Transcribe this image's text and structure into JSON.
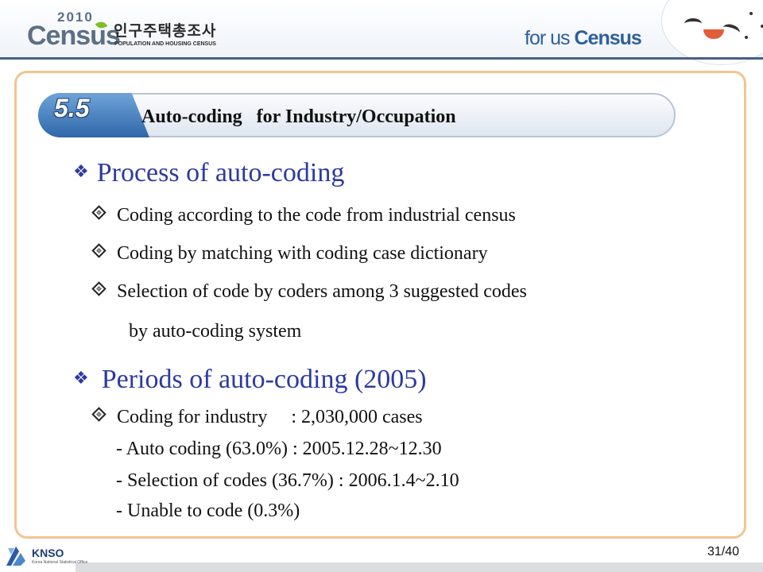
{
  "header": {
    "logo_year": "2010",
    "logo_word": "Census",
    "logo_korean": "인구주택총조사",
    "logo_subtitle": "POPULATION AND HOUSING CENSUS",
    "slogan_prefix": "for us ",
    "slogan_word": "Census"
  },
  "section": {
    "number": "5.5",
    "title": "Auto-coding   for Industry/Occupation"
  },
  "content": {
    "heading1": "Process of auto-coding",
    "items1": [
      "Coding according to the code from industrial census",
      "Coding by matching with coding case dictionary",
      "Selection of code by coders among 3 suggested codes"
    ],
    "items1_continuation": "by auto-coding system",
    "heading2": "Periods of auto-coding (2005)",
    "item2": "Coding for industry     : 2,030,000 cases",
    "subitems2": [
      "- Auto coding (63.0%) : 2005.12.28~12.30",
      "- Selection of codes (36.7%) : 2006.1.4~2.10",
      "- Unable to code (0.3%)"
    ]
  },
  "footer": {
    "org": "KNSO",
    "org_full": "Korea National Statistical Office",
    "page": "31/40"
  },
  "colors": {
    "heading": "#2d3aa0",
    "panel_border": "#f2c590",
    "header_rule": "#4a5f83",
    "section_tab": "#2f67a8"
  },
  "icons": {
    "heading_bullet": "four-diamond-icon",
    "item_bullet": "diamond-bullet-icon"
  }
}
